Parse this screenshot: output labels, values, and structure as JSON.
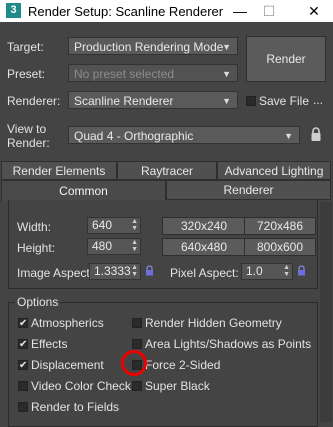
{
  "window": {
    "icon_label": "3",
    "title": "Render Setup: Scanline Renderer",
    "minimize": "—",
    "maximize": "☐",
    "close": "✕"
  },
  "top": {
    "target_label": "Target:",
    "target_value": "Production Rendering Mode",
    "preset_label": "Preset:",
    "preset_value": "No preset selected",
    "renderer_label": "Renderer:",
    "renderer_value": "Scanline Renderer",
    "save_file_label": "Save File",
    "more_label": "...",
    "view_label_1": "View to",
    "view_label_2": "Render:",
    "view_value": "Quad 4 - Orthographic",
    "render_button": "Render"
  },
  "tabs": {
    "row1": [
      "Render Elements",
      "Raytracer",
      "Advanced Lighting"
    ],
    "row2": [
      "Common",
      "Renderer"
    ],
    "active": "Common"
  },
  "output_size": {
    "width_label": "Width:",
    "width_value": "640",
    "height_label": "Height:",
    "height_value": "480",
    "presets": [
      "320x240",
      "720x486",
      "640x480",
      "800x600"
    ],
    "image_aspect_label": "Image Aspect:",
    "image_aspect_value": "1.3333",
    "pixel_aspect_label": "Pixel Aspect:",
    "pixel_aspect_value": "1.0"
  },
  "options": {
    "title": "Options",
    "left": [
      {
        "label": "Atmospherics",
        "checked": true
      },
      {
        "label": "Effects",
        "checked": true
      },
      {
        "label": "Displacement",
        "checked": true
      },
      {
        "label": "Video Color Check",
        "checked": false
      },
      {
        "label": "Render to Fields",
        "checked": false
      }
    ],
    "right": [
      {
        "label": "Render Hidden Geometry",
        "checked": false
      },
      {
        "label": "Area Lights/Shadows as Points",
        "checked": false
      },
      {
        "label": "Force 2-Sided",
        "checked": false
      },
      {
        "label": "Super Black",
        "checked": false
      }
    ]
  },
  "colors": {
    "background": "#444444",
    "annotation": "#ee0000"
  }
}
